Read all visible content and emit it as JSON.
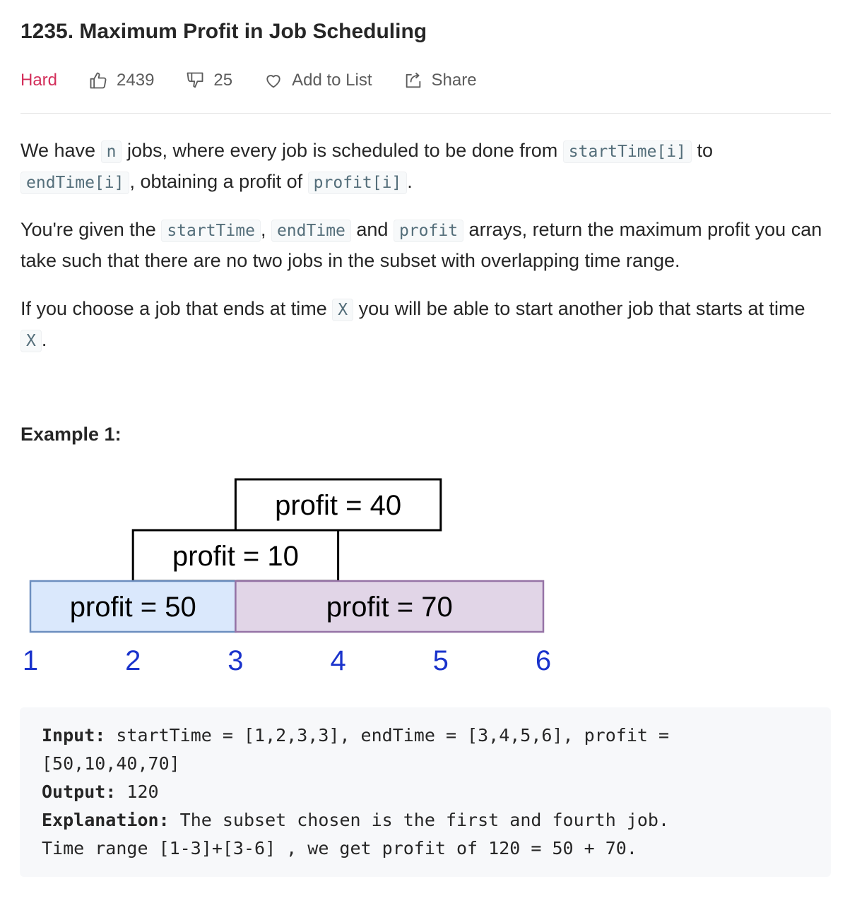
{
  "problem": {
    "title": "1235. Maximum Profit in Job Scheduling",
    "difficulty": "Hard",
    "likes": "2439",
    "dislikes": "25",
    "add_to_list": "Add to List",
    "share": "Share"
  },
  "description": {
    "p1": {
      "t1": "We have ",
      "c1": "n",
      "t2": " jobs, where every job is scheduled to be done from ",
      "c2": "startTime[i]",
      "t3": " to ",
      "c3": "endTime[i]",
      "t4": ", obtaining a profit of ",
      "c4": "profit[i]",
      "t5": "."
    },
    "p2": {
      "t1": "You're given the ",
      "c1": "startTime",
      "t2": ", ",
      "c2": "endTime",
      "t3": " and ",
      "c3": "profit",
      "t4": " arrays, return the maximum profit you can take such that there are no two jobs in the subset with overlapping time range."
    },
    "p3": {
      "t1": "If you choose a job that ends at time ",
      "c1": "X",
      "t2": " you will be able to start another job that starts at time ",
      "c2": "X",
      "t3": "."
    }
  },
  "example": {
    "title": "Example 1:",
    "input_label": "Input:",
    "input_line1": " startTime = [1,2,3,3], endTime = [3,4,5,6], profit =",
    "input_line2": "[50,10,40,70]",
    "output_label": "Output:",
    "output_value": " 120",
    "explanation_label": "Explanation:",
    "explanation_line1": " The subset chosen is the first and fourth job.",
    "explanation_line2": "Time range [1-3]+[3-6] , we get profit of 120 = 50 + 70."
  },
  "diagram": {
    "jobs": [
      {
        "label": "profit = 40",
        "start": 3,
        "end": 5,
        "level": 3,
        "fill": "#ffffff",
        "stroke": "#000000"
      },
      {
        "label": "profit = 10",
        "start": 2,
        "end": 4,
        "level": 2,
        "fill": "#ffffff",
        "stroke": "#000000"
      },
      {
        "label": "profit = 50",
        "start": 1,
        "end": 3,
        "level": 1,
        "fill": "#dae8fc",
        "stroke": "#6c8ebf"
      },
      {
        "label": "profit = 70",
        "start": 3,
        "end": 6,
        "level": 1,
        "fill": "#e1d5e7",
        "stroke": "#9673a6"
      }
    ],
    "axis_labels": [
      "1",
      "2",
      "3",
      "4",
      "5",
      "6"
    ],
    "axis_color": "#1a33cc"
  }
}
